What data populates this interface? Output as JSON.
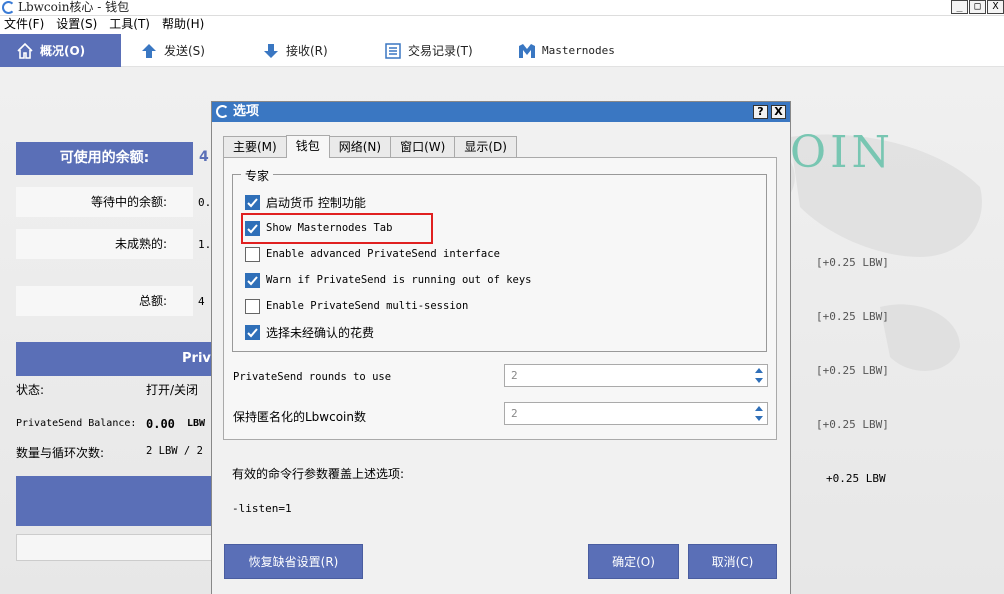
{
  "window": {
    "title": "Lbwcoin核心 - 钱包",
    "buttons": [
      "_",
      "□",
      "X"
    ]
  },
  "menu": [
    "文件(F)",
    "设置(S)",
    "工具(T)",
    "帮助(H)"
  ],
  "toolbar": {
    "items": [
      {
        "label": "概况(O)",
        "icon": "home-icon",
        "active": true
      },
      {
        "label": "发送(S)",
        "icon": "arrow-up-icon"
      },
      {
        "label": "接收(R)",
        "icon": "arrow-down-icon"
      },
      {
        "label": "交易记录(T)",
        "icon": "list-icon"
      },
      {
        "label": "Masternodes",
        "icon": "masternode-icon"
      }
    ]
  },
  "overview": {
    "brand_watermark": "OIN",
    "available_label": "可使用的余额:",
    "available_value": "4",
    "pending_label": "等待中的余额:",
    "pending_value": "0.",
    "immature_label": "未成熟的:",
    "immature_value": "1.",
    "total_label": "总额:",
    "total_value": "4",
    "privatesend_header": "Priv",
    "status_label": "状态:",
    "status_value": "打开/关闭",
    "ps_balance_label": "PrivateSend Balance:",
    "ps_balance_value": "0.00",
    "ps_balance_unit": "LBW",
    "rounds_label": "数量与循环次数:",
    "rounds_value": "2  LBW / 2",
    "transactions": [
      "[+0.25 LBW]",
      "[+0.25 LBW]",
      "[+0.25 LBW]",
      "[+0.25 LBW]",
      "+0.25 LBW"
    ]
  },
  "dialog": {
    "title": "选项",
    "help_button": "?",
    "close_button": "X",
    "tabs": [
      "主要(M)",
      "钱包",
      "网络(N)",
      "窗口(W)",
      "显示(D)"
    ],
    "active_tab": "钱包",
    "expert_group": "专家",
    "options": [
      {
        "label": "启动货币 控制功能",
        "checked": true
      },
      {
        "label": "Show Masternodes Tab",
        "checked": true
      },
      {
        "label": "Enable advanced PrivateSend interface",
        "checked": false
      },
      {
        "label": "Warn if PrivateSend is running out of keys",
        "checked": true
      },
      {
        "label": "Enable PrivateSend multi-session",
        "checked": false
      },
      {
        "label": "选择未经确认的花费",
        "checked": true
      }
    ],
    "rounds_label": "PrivateSend rounds to use",
    "rounds_value": "2",
    "anon_label": "保持匿名化的Lbwcoin数",
    "anon_value": "2",
    "override_note": "有效的命令行参数覆盖上述选项:",
    "cmdline": "-listen=1",
    "reset_button": "恢复缺省设置(R)",
    "ok_button": "确定(O)",
    "cancel_button": "取消(C)"
  },
  "colors": {
    "accent": "#5a6fb7",
    "dialog_title": "#3a77c2",
    "checkbox": "#2f6fb8",
    "highlight": "#e02020",
    "watermark": "#78c6b2"
  }
}
